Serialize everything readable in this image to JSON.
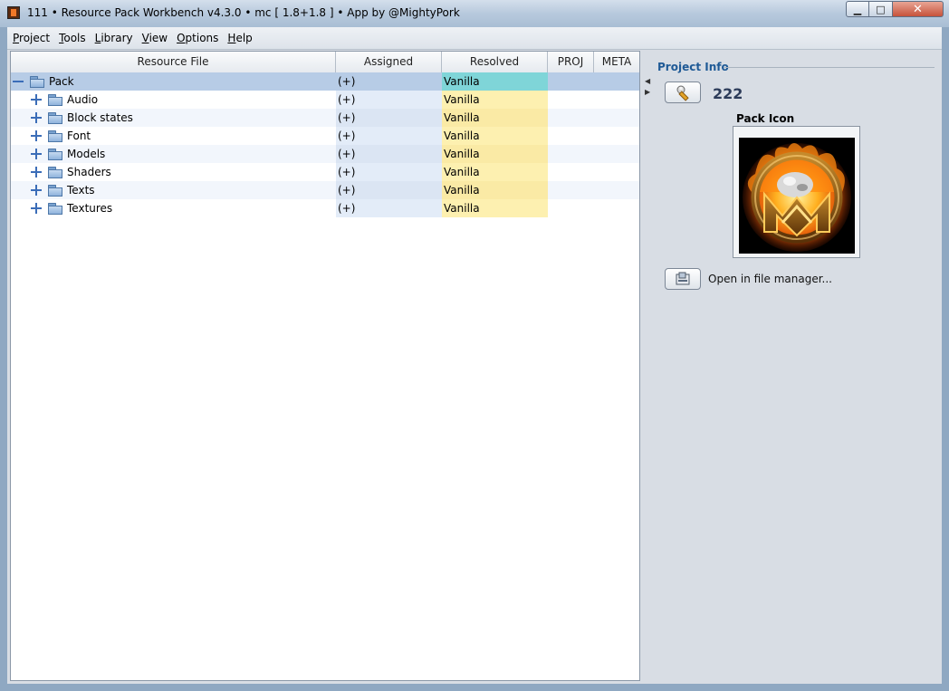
{
  "window": {
    "title": "111  •  Resource Pack Workbench v4.3.0  •  mc [ 1.8+1.8 ]  •  App by @MightyPork",
    "minimize": "▁",
    "maximize": "□",
    "close": "✕"
  },
  "menu": [
    "Project",
    "Tools",
    "Library",
    "View",
    "Options",
    "Help"
  ],
  "table": {
    "columns": [
      "Resource File",
      "Assigned",
      "Resolved",
      "PROJ",
      "META"
    ],
    "rows": [
      {
        "name": "Pack",
        "assigned": "(+)",
        "resolved": "Vanilla",
        "proj": "",
        "meta": ""
      },
      {
        "name": "Audio",
        "assigned": "(+)",
        "resolved": "Vanilla",
        "proj": "",
        "meta": ""
      },
      {
        "name": "Block states",
        "assigned": "(+)",
        "resolved": "Vanilla",
        "proj": "",
        "meta": ""
      },
      {
        "name": "Font",
        "assigned": "(+)",
        "resolved": "Vanilla",
        "proj": "",
        "meta": ""
      },
      {
        "name": "Models",
        "assigned": "(+)",
        "resolved": "Vanilla",
        "proj": "",
        "meta": ""
      },
      {
        "name": "Shaders",
        "assigned": "(+)",
        "resolved": "Vanilla",
        "proj": "",
        "meta": ""
      },
      {
        "name": "Texts",
        "assigned": "(+)",
        "resolved": "Vanilla",
        "proj": "",
        "meta": ""
      },
      {
        "name": "Textures",
        "assigned": "(+)",
        "resolved": "Vanilla",
        "proj": "",
        "meta": ""
      }
    ]
  },
  "project_info": {
    "section_title": "Project Info",
    "project_name": "222",
    "pack_icon_label": "Pack Icon",
    "open_file_manager": "Open in file manager..."
  },
  "colors": {
    "resolved_cell": "#fdf0b0",
    "selected_row": "#b7cce6",
    "selected_resolved": "#7fd5d8",
    "accent_title": "#1f5a96"
  },
  "icons": {
    "pack_icon": "flaming-mp-emblem",
    "edit_button": "wrench-icon",
    "open_button": "folder-open-icon"
  }
}
